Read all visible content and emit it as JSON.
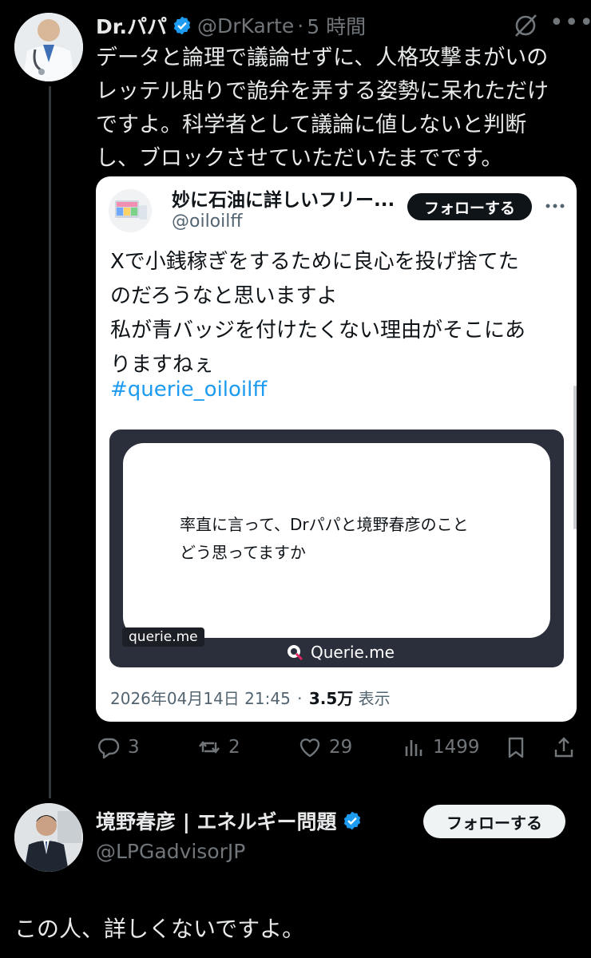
{
  "tweet": {
    "author_name": "Dr.パパ",
    "handle": "@DrKarte",
    "dot": "·",
    "time": "5 時間",
    "lines": [
      "データと論理で議論せずに、人格攻撃まがいの",
      "レッテル貼りで詭弁を弄する姿勢に呆れただけ",
      "ですよ。科学者として議論に値しないと判断",
      "し、ブロックさせていただいたまでです。"
    ],
    "icons": {
      "verified": "verified-badge-icon",
      "grok": "grok-icon",
      "more": "more-icon"
    }
  },
  "quote": {
    "author_name": "妙に石油に詳しいフリー...",
    "handle": "@oiloilff",
    "follow_label": "フォローする",
    "lines": [
      "Xで小銭稼ぎをするために良心を投げ捨てた",
      "のだろうなと思いますよ",
      "私が青バッジを付けたくない理由がそこにあ",
      "りますねぇ"
    ],
    "hashtag": "#querie_oiloilff",
    "media": {
      "lines": [
        "率直に言って、Drパパと境野春彦のこと",
        "どう思ってますか"
      ],
      "badge": "querie.me",
      "brand": "Querie.me"
    },
    "timestamp": "2026年04月14日 21:45",
    "meta_dot": "·",
    "views_count": "3.5万",
    "views_label": "表示"
  },
  "actions": {
    "replies": "3",
    "reposts": "2",
    "likes": "29",
    "views": "1499"
  },
  "reply": {
    "author_name": "境野春彦 | エネルギー問題",
    "handle": "@LPGadvisorJP",
    "follow_label": "フォローする",
    "text": "この人、詳しくないですよ。"
  },
  "colors": {
    "background": "#000000",
    "verified": "#1d9bf0",
    "link": "#1d9bf0",
    "muted": "#71767b"
  }
}
